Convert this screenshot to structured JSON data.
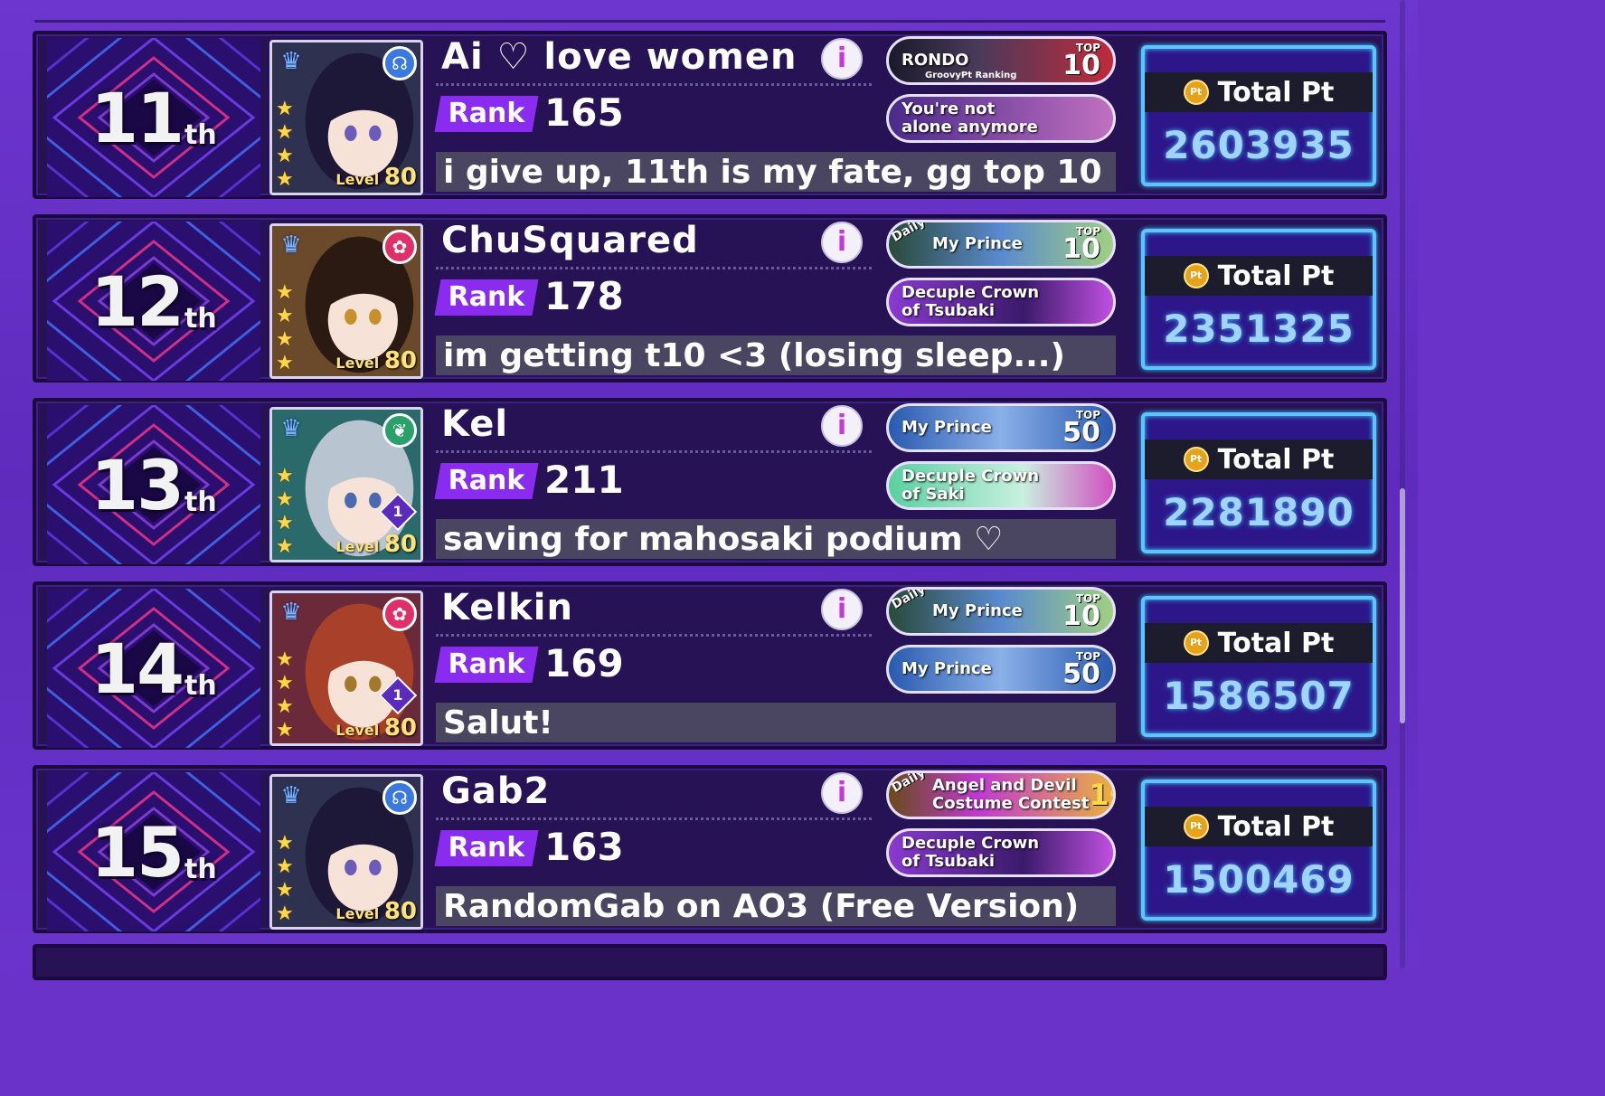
{
  "rows": [
    {
      "rank_num": "11",
      "rank_suffix": "th",
      "name": "Ai ♡ love women",
      "rank_label": "Rank",
      "rank": "165",
      "comment": "i give up, 11th is my fate, gg top 10",
      "level_label": "Level",
      "level": "80",
      "badge1": {
        "text": "RONDO",
        "sub": "GroovyPt Ranking",
        "top_label": "TOP",
        "top": "10"
      },
      "badge2": {
        "text": "You're not\nalone anymore"
      },
      "total_label": "Total Pt",
      "total": "2603935"
    },
    {
      "rank_num": "12",
      "rank_suffix": "th",
      "name": "ChuSquared",
      "rank_label": "Rank",
      "rank": "178",
      "comment": "im getting t10 <3 (losing sleep...)",
      "level_label": "Level",
      "level": "80",
      "badge1": {
        "daily": "Daily",
        "text": "My Prince",
        "top_label": "TOP",
        "top": "10"
      },
      "badge2": {
        "text": "Decuple Crown\nof Tsubaki"
      },
      "total_label": "Total Pt",
      "total": "2351325"
    },
    {
      "rank_num": "13",
      "rank_suffix": "th",
      "name": "Kel",
      "rank_label": "Rank",
      "rank": "211",
      "comment": "saving for mahosaki podium ♡",
      "level_label": "Level",
      "level": "80",
      "training": "1",
      "badge1": {
        "text": "My Prince",
        "top_label": "TOP",
        "top": "50"
      },
      "badge2": {
        "text": "Decuple Crown\nof Saki"
      },
      "total_label": "Total Pt",
      "total": "2281890"
    },
    {
      "rank_num": "14",
      "rank_suffix": "th",
      "name": "Kelkin",
      "rank_label": "Rank",
      "rank": "169",
      "comment": "Salut!",
      "level_label": "Level",
      "level": "80",
      "training": "1",
      "badge1": {
        "daily": "Daily",
        "text": "My Prince",
        "top_label": "TOP",
        "top": "10"
      },
      "badge2": {
        "text": "My Prince",
        "top_label": "TOP",
        "top": "50"
      },
      "total_label": "Total Pt",
      "total": "1586507"
    },
    {
      "rank_num": "15",
      "rank_suffix": "th",
      "name": "Gab2",
      "rank_label": "Rank",
      "rank": "163",
      "comment": "RandomGab on AO3 (Free Version)",
      "level_label": "Level",
      "level": "80",
      "badge1": {
        "daily": "Daily",
        "text": "Angel and Devil\nCostume Contest",
        "top": "1st"
      },
      "badge2": {
        "text": "Decuple Crown\nof Tsubaki"
      },
      "total_label": "Total Pt",
      "total": "1500469"
    }
  ],
  "colors": {
    "background": "#6a32c8",
    "row_bg": "#261255",
    "rank_badge": "#8a2cf0",
    "total_border": "#5ec4ff",
    "total_value": "#9fd4ff"
  },
  "icons": {
    "info": "info-icon",
    "coin": "event-point-coin-icon",
    "star": "rarity-star-icon"
  },
  "coin_text": "Pt"
}
